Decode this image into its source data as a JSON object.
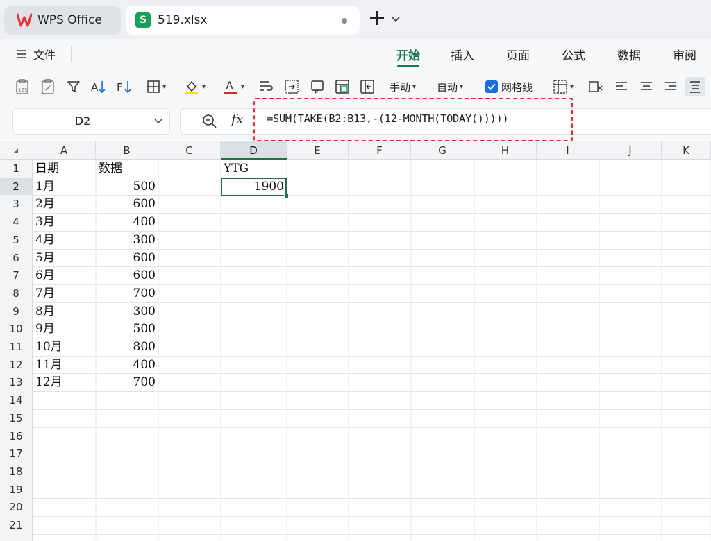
{
  "titlebar": {
    "home_tab_label": "WPS Office",
    "file_tab_label": "519.xlsx",
    "file_tab_icon": "spreadsheet-s-icon",
    "file_tab_icon_letter": "S"
  },
  "menu": {
    "file_label": "文件",
    "tabs": [
      {
        "label": "开始",
        "active": true
      },
      {
        "label": "插入",
        "active": false
      },
      {
        "label": "页面",
        "active": false
      },
      {
        "label": "公式",
        "active": false
      },
      {
        "label": "数据",
        "active": false
      },
      {
        "label": "审阅",
        "active": false
      }
    ],
    "accent_color": "#18794e"
  },
  "toolbar": {
    "calc_manual_label": "手动",
    "calc_auto_label": "自动",
    "gridlines_label": "网格线",
    "gridlines_checked": true
  },
  "formula_bar": {
    "name_box": "D2",
    "fx_label": "fx",
    "formula": "=SUM(TAKE(B2:B13,-(12-MONTH(TODAY()))))",
    "highlight_color": "#e03030"
  },
  "sheet": {
    "columns": [
      "A",
      "B",
      "C",
      "D",
      "E",
      "F",
      "G",
      "H",
      "I",
      "J",
      "K"
    ],
    "selected_column": "D",
    "row_numbers": [
      "1",
      "2",
      "3",
      "4",
      "5",
      "6",
      "7",
      "8",
      "9",
      "10",
      "11",
      "12",
      "13",
      "14",
      "15",
      "16",
      "17",
      "18",
      "19",
      "20",
      "21"
    ],
    "selected_row": "2",
    "header": {
      "A": "日期",
      "B": "数据",
      "D": "YTG"
    },
    "rows": [
      {
        "A": "1月",
        "B": "500",
        "D": "1900"
      },
      {
        "A": "2月",
        "B": "600"
      },
      {
        "A": "3月",
        "B": "400"
      },
      {
        "A": "4月",
        "B": "300"
      },
      {
        "A": "5月",
        "B": "600"
      },
      {
        "A": "6月",
        "B": "600"
      },
      {
        "A": "7月",
        "B": "700"
      },
      {
        "A": "8月",
        "B": "300"
      },
      {
        "A": "9月",
        "B": "500"
      },
      {
        "A": "10月",
        "B": "800"
      },
      {
        "A": "11月",
        "B": "400"
      },
      {
        "A": "12月",
        "B": "700"
      }
    ],
    "selection_color": "#217346"
  }
}
